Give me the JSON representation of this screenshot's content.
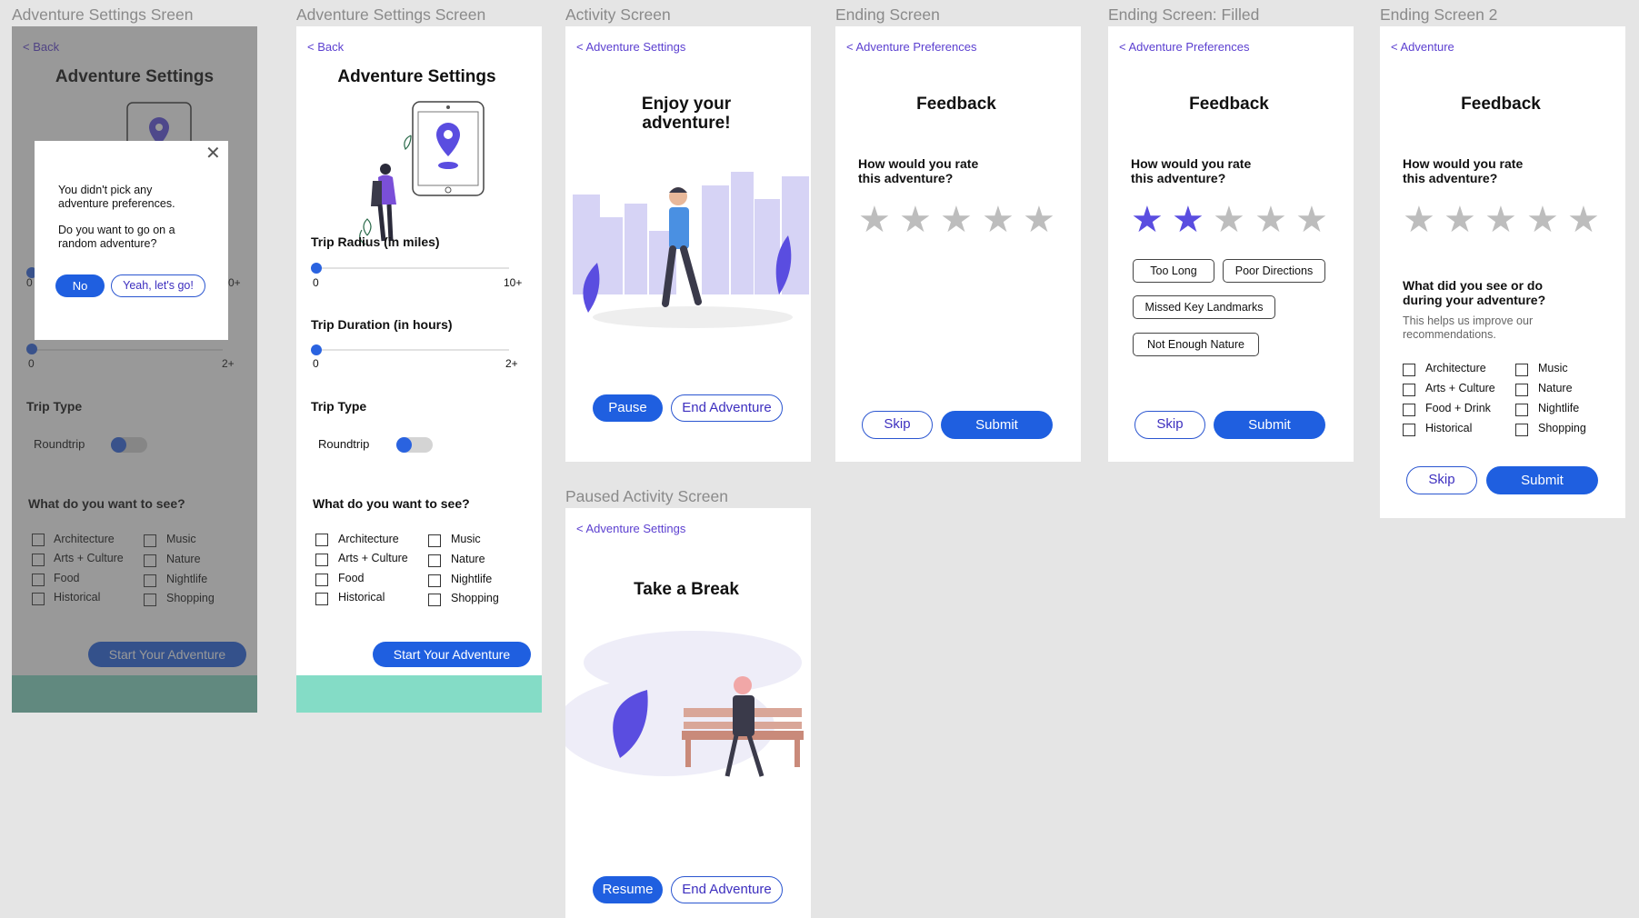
{
  "frames": {
    "f1": {
      "label": "Adventure Settings Sreen"
    },
    "f2": {
      "label": "Adventure Settings Screen"
    },
    "f3": {
      "label": "Activity Screen"
    },
    "f4": {
      "label": "Ending Screen"
    },
    "f5": {
      "label": "Ending Screen: Filled"
    },
    "f6": {
      "label": "Ending Screen 2"
    },
    "f7": {
      "label": "Paused Activity Screen"
    }
  },
  "settings": {
    "back": "< Back",
    "title": "Adventure Settings",
    "radius_label": "Trip Radius (in miles)",
    "radius_min": "0",
    "radius_max": "10+",
    "duration_label": "Trip Duration (in hours)",
    "duration_min": "0",
    "duration_max": "2+",
    "trip_type_label": "Trip Type",
    "roundtrip": "Roundtrip",
    "see_label": "What do you want to see?",
    "options_left": [
      "Architecture",
      "Arts + Culture",
      "Food",
      "Historical"
    ],
    "options_right": [
      "Music",
      "Nature",
      "Nightlife",
      "Shopping"
    ],
    "start": "Start Your Adventure",
    "partial_radius_max": "0+"
  },
  "modal": {
    "line1": "You didn't pick any",
    "line2": "adventure preferences.",
    "line3": "Do you want to go on a",
    "line4": "random adventure?",
    "no": "No",
    "yes": "Yeah, let's go!"
  },
  "activity": {
    "back": "< Adventure Settings",
    "title1": "Enjoy your",
    "title2": "adventure!",
    "pause": "Pause",
    "end": "End Adventure"
  },
  "paused": {
    "back": "< Adventure Settings",
    "title": "Take a Break",
    "resume": "Resume",
    "end": "End Adventure"
  },
  "feedback": {
    "back_prefs": "< Adventure Preferences",
    "back_adv": "< Adventure",
    "title": "Feedback",
    "q1": "How would you rate",
    "q2": "this adventure?",
    "skip": "Skip",
    "submit": "Submit",
    "filled_rating": 2,
    "chips": [
      "Too Long",
      "Poor Directions",
      "Missed Key Landmarks",
      "Not Enough Nature"
    ],
    "see_q1": "What did you see or do",
    "see_q2": "during your adventure?",
    "help1": "This helps us improve our",
    "help2": "recommendations.",
    "options_left": [
      "Architecture",
      "Arts + Culture",
      "Food + Drink",
      "Historical"
    ],
    "options_right": [
      "Music",
      "Nature",
      "Nightlife",
      "Shopping"
    ]
  },
  "colors": {
    "primary": "#1f5fe0",
    "accent": "#5a4de0",
    "teal": "#84dcc6"
  }
}
